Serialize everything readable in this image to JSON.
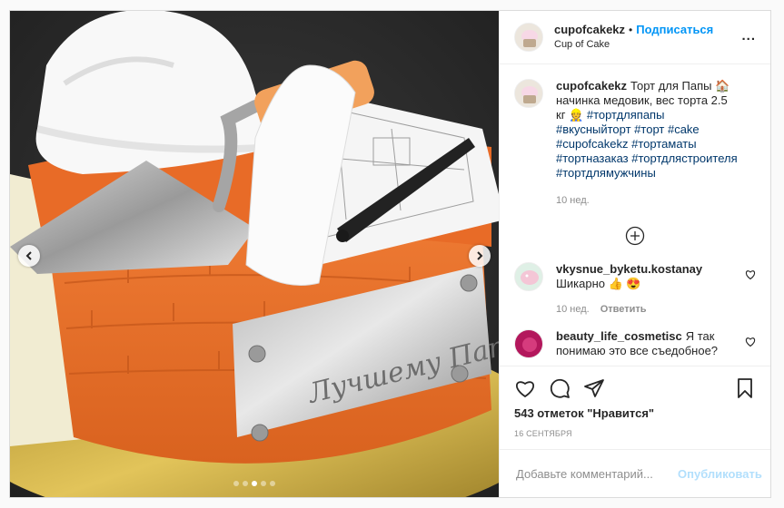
{
  "header": {
    "username": "cupofcakekz",
    "separator": "•",
    "follow_label": "Подписаться",
    "location": "Cup of Cake",
    "more_label": "..."
  },
  "caption": {
    "username": "cupofcakekz",
    "text": "Торт для Папы 🏠 начинка медовик, вес торта 2.5 кг 👷 ",
    "hashtags": [
      "#тортдляпапы",
      "#вкусныйторт",
      "#торт",
      "#cake",
      "#cupofcakekz",
      "#тортаматы",
      "#тортназаказ",
      "#тортдлястроителя",
      "#тортдлямужчины"
    ],
    "time": "10 нед."
  },
  "comments": [
    {
      "username": "vkysnue_byketu.kostanay",
      "text": "Шикарно 👍 😍",
      "time": "10 нед.",
      "reply_label": "Ответить"
    },
    {
      "username": "beauty_life_cosmetisc",
      "text": "Я так понимаю это все съедобное?",
      "time": "",
      "reply_label": ""
    }
  ],
  "actions": {
    "likes": "543 отметок \"Нравится\"",
    "date": "16 сентября"
  },
  "comment_box": {
    "placeholder": "Добавьте комментарий...",
    "publish_label": "Опубликовать"
  },
  "image": {
    "description_icon": "cake-photo",
    "plaque_text": "Лучшему Папе!",
    "carousel": {
      "count": 5,
      "active": 2
    }
  },
  "colors": {
    "accent": "#0095f6",
    "tag": "#00376b",
    "muted": "#8e8e8e",
    "cake_orange": "#e8702a"
  }
}
